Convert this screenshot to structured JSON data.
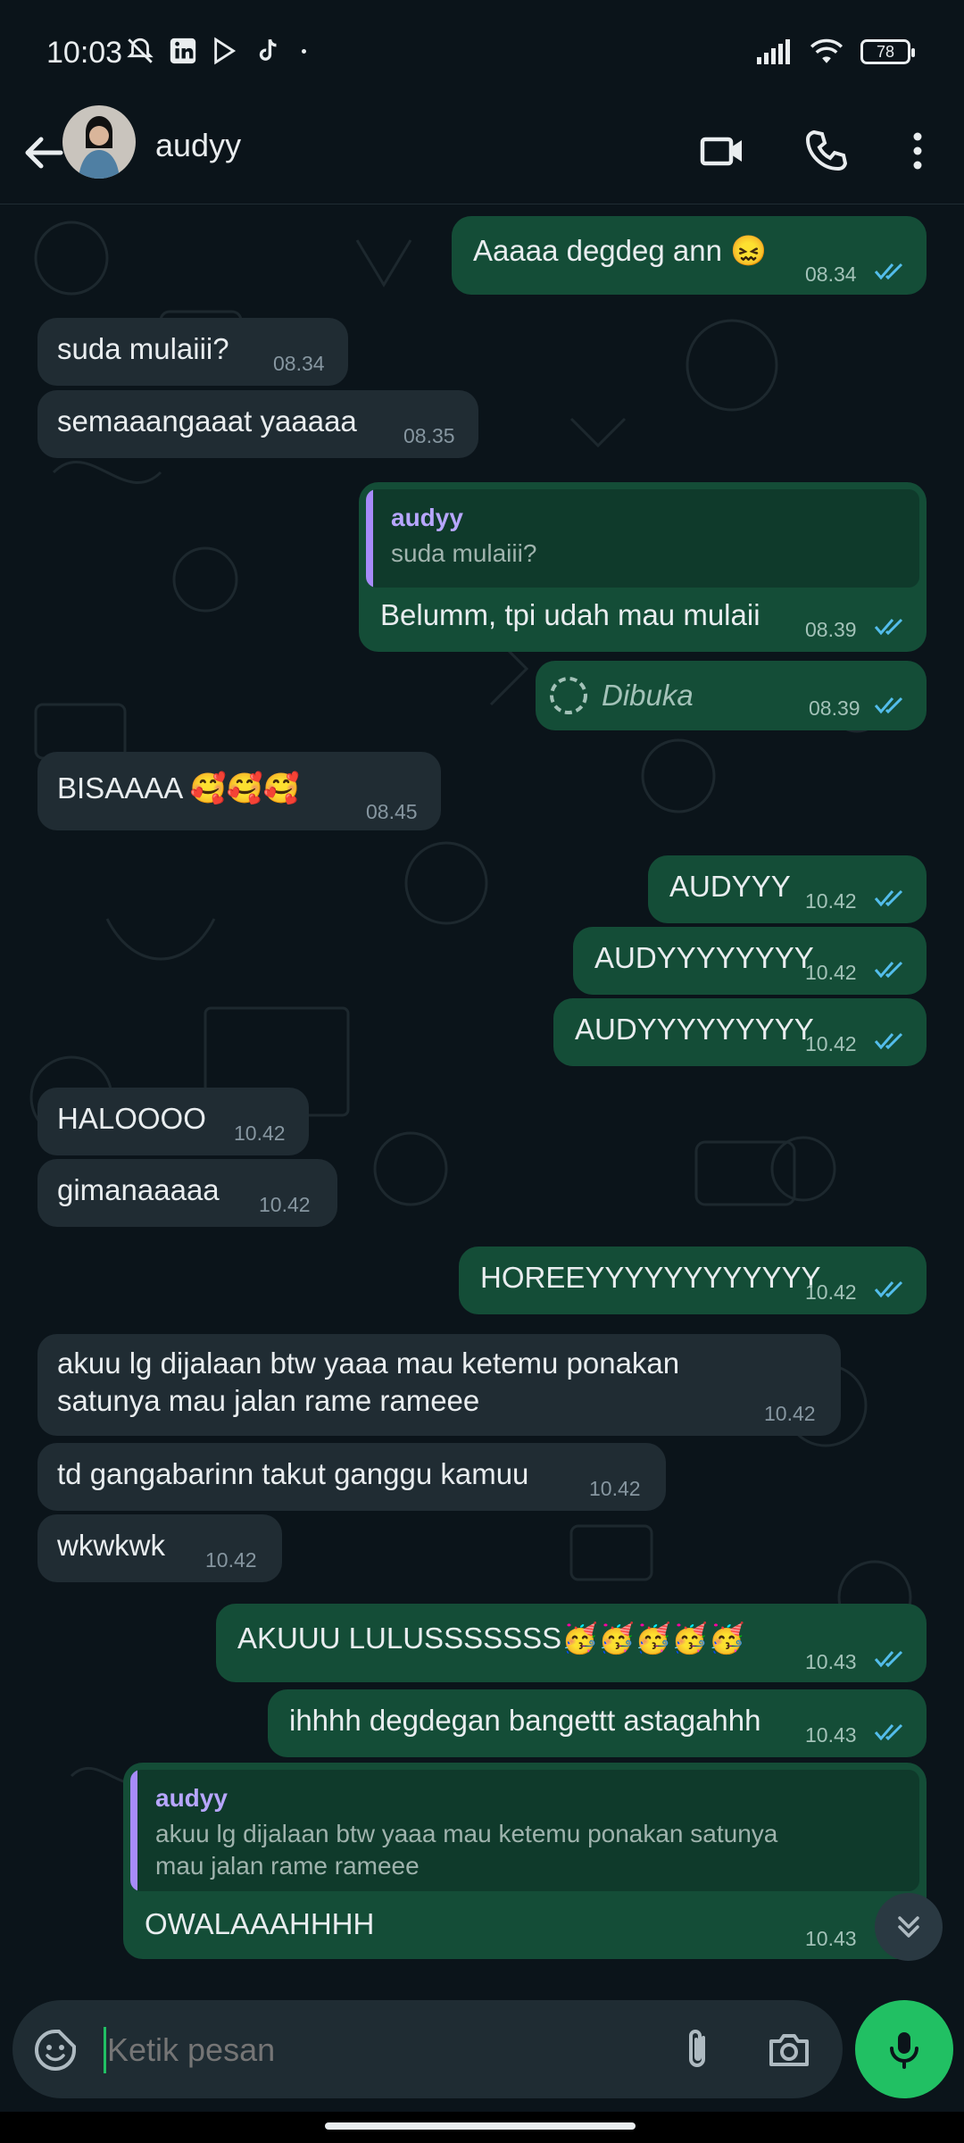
{
  "status_bar": {
    "time": "10:03",
    "battery": "78"
  },
  "header": {
    "contact_name": "audyy"
  },
  "messages": [
    {
      "dir": "out",
      "text": "Aaaaa degdeg ann 😖",
      "time": "08.34"
    },
    {
      "dir": "in",
      "text": "suda mulaiii?",
      "time": "08.34"
    },
    {
      "dir": "in",
      "text": "semaaangaaat yaaaaa",
      "time": "08.35"
    },
    {
      "dir": "out",
      "quote_author": "audyy",
      "quote_text": "suda mulaiii?",
      "text": "Belumm, tpi udah mau mulaii",
      "time": "08.39"
    },
    {
      "dir": "out",
      "text": "Dibuka",
      "time": "08.39"
    },
    {
      "dir": "in",
      "text": "BISAAAA 🥰🥰🥰",
      "time": "08.45"
    },
    {
      "dir": "out",
      "text": "AUDYYY",
      "time": "10.42"
    },
    {
      "dir": "out",
      "text": "AUDYYYYYYYY",
      "time": "10.42"
    },
    {
      "dir": "out",
      "text": "AUDYYYYYYYYY",
      "time": "10.42"
    },
    {
      "dir": "in",
      "text": "HALOOOO",
      "time": "10.42"
    },
    {
      "dir": "in",
      "text": "gimanaaaaa",
      "time": "10.42"
    },
    {
      "dir": "out",
      "text": "HOREEYYYYYYYYYYYY",
      "time": "10.42"
    },
    {
      "dir": "in",
      "text_line1": "akuu lg dijalaan btw yaaa mau ketemu ponakan",
      "text_line2": "satunya mau jalan rame rameee",
      "time": "10.42"
    },
    {
      "dir": "in",
      "text": "td gangabarinn takut ganggu kamuu",
      "time": "10.42"
    },
    {
      "dir": "in",
      "text": "wkwkwk",
      "time": "10.42"
    },
    {
      "dir": "out",
      "text": "AKUUU LULUSSSSSSS🥳🥳🥳🥳🥳",
      "time": "10.43"
    },
    {
      "dir": "out",
      "text": "ihhhh degdegan bangettt astagahhh",
      "time": "10.43"
    },
    {
      "dir": "out",
      "quote_author": "audyy",
      "quote_line1": "akuu lg dijalaan btw yaaa mau ketemu ponakan satunya",
      "quote_line2": "mau jalan rame rameee",
      "text": "OWALAAAHHHH",
      "time": "10.43"
    }
  ],
  "composer": {
    "placeholder": "Ketik pesan"
  },
  "icons": {
    "back": "arrow-left-icon",
    "video": "video-call-icon",
    "call": "phone-icon",
    "menu": "more-vertical-icon",
    "emoji": "sticker-icon",
    "attach": "paperclip-icon",
    "camera": "camera-icon",
    "mic": "mic-icon",
    "scroll_down": "double-chevron-down-icon"
  },
  "colors": {
    "background": "#0b141a",
    "outgoing_bubble": "#144d37",
    "incoming_bubble": "#202c33",
    "read_ticks": "#53bdeb",
    "mic_button": "#21c063",
    "quote_accent": "#a78bfa"
  }
}
